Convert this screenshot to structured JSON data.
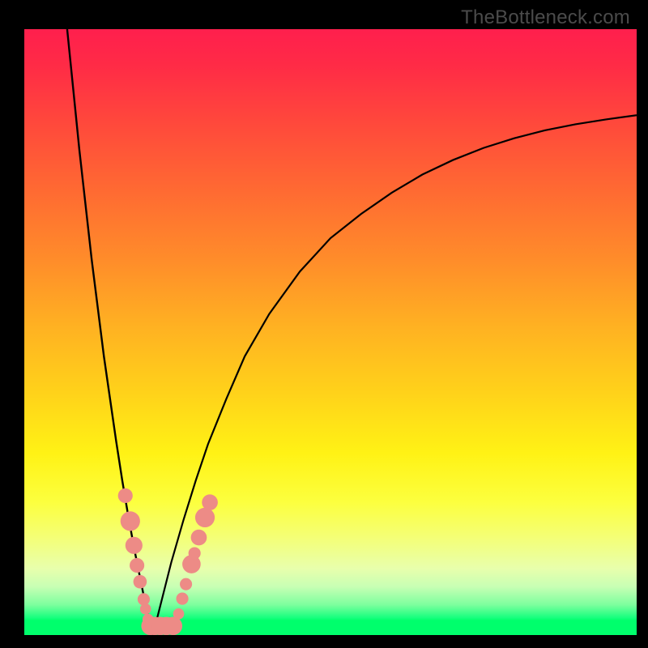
{
  "watermark": "TheBottleneck.com",
  "colors": {
    "page_bg": "#000000",
    "curve_stroke": "#000000",
    "marker_fill": "#ed8b86",
    "gradient_top": "#ff1f4d",
    "gradient_bottom": "#00ff6c"
  },
  "chart_data": {
    "type": "line",
    "title": "",
    "xlabel": "",
    "ylabel": "",
    "xlim": [
      0,
      100
    ],
    "ylim": [
      0,
      100
    ],
    "grid": false,
    "legend": false,
    "description": "V-shaped bottleneck curve on vertical red→green gradient; minimum near x≈21 where y≈0. Salmon markers cluster near the valley on both branches.",
    "series": [
      {
        "name": "left-branch",
        "x": [
          7,
          8,
          9,
          10,
          11,
          12,
          13,
          14,
          15,
          16,
          17,
          18,
          19,
          20,
          21
        ],
        "y": [
          100,
          90,
          80,
          71,
          62,
          54,
          46,
          39,
          32,
          25.5,
          19.5,
          14,
          9,
          4,
          0
        ]
      },
      {
        "name": "right-branch",
        "x": [
          21,
          22,
          24,
          26,
          28,
          30,
          33,
          36,
          40,
          45,
          50,
          55,
          60,
          65,
          70,
          75,
          80,
          85,
          90,
          95,
          100
        ],
        "y": [
          0,
          4,
          12,
          19,
          25.5,
          31.5,
          39,
          46,
          53,
          60,
          65.5,
          69.5,
          73,
          76,
          78.4,
          80.4,
          82,
          83.3,
          84.3,
          85.1,
          85.8
        ]
      }
    ],
    "markers": {
      "name": "data-points",
      "shape": "circle",
      "color": "#ed8b86",
      "points": [
        {
          "x": 16.5,
          "y": 23,
          "r": 1.2
        },
        {
          "x": 17.3,
          "y": 18.8,
          "r": 1.6
        },
        {
          "x": 17.9,
          "y": 14.8,
          "r": 1.4
        },
        {
          "x": 18.4,
          "y": 11.5,
          "r": 1.2
        },
        {
          "x": 18.9,
          "y": 8.8,
          "r": 1.1
        },
        {
          "x": 19.5,
          "y": 5.9,
          "r": 1.0
        },
        {
          "x": 19.8,
          "y": 4.3,
          "r": 0.9
        },
        {
          "x": 20.2,
          "y": 2.6,
          "r": 0.9
        },
        {
          "x": 20.6,
          "y": 1.5,
          "r": 1.5
        },
        {
          "x": 21.3,
          "y": 1.5,
          "r": 1.5
        },
        {
          "x": 22.2,
          "y": 1.5,
          "r": 1.5
        },
        {
          "x": 23.2,
          "y": 1.5,
          "r": 1.5
        },
        {
          "x": 24.3,
          "y": 1.5,
          "r": 1.5
        },
        {
          "x": 25.2,
          "y": 3.5,
          "r": 0.9
        },
        {
          "x": 25.8,
          "y": 6.0,
          "r": 1.0
        },
        {
          "x": 26.4,
          "y": 8.4,
          "r": 1.0
        },
        {
          "x": 27.3,
          "y": 11.7,
          "r": 1.5
        },
        {
          "x": 27.8,
          "y": 13.5,
          "r": 1.0
        },
        {
          "x": 28.5,
          "y": 16.1,
          "r": 1.3
        },
        {
          "x": 29.5,
          "y": 19.4,
          "r": 1.6
        },
        {
          "x": 30.3,
          "y": 21.9,
          "r": 1.3
        }
      ]
    }
  }
}
